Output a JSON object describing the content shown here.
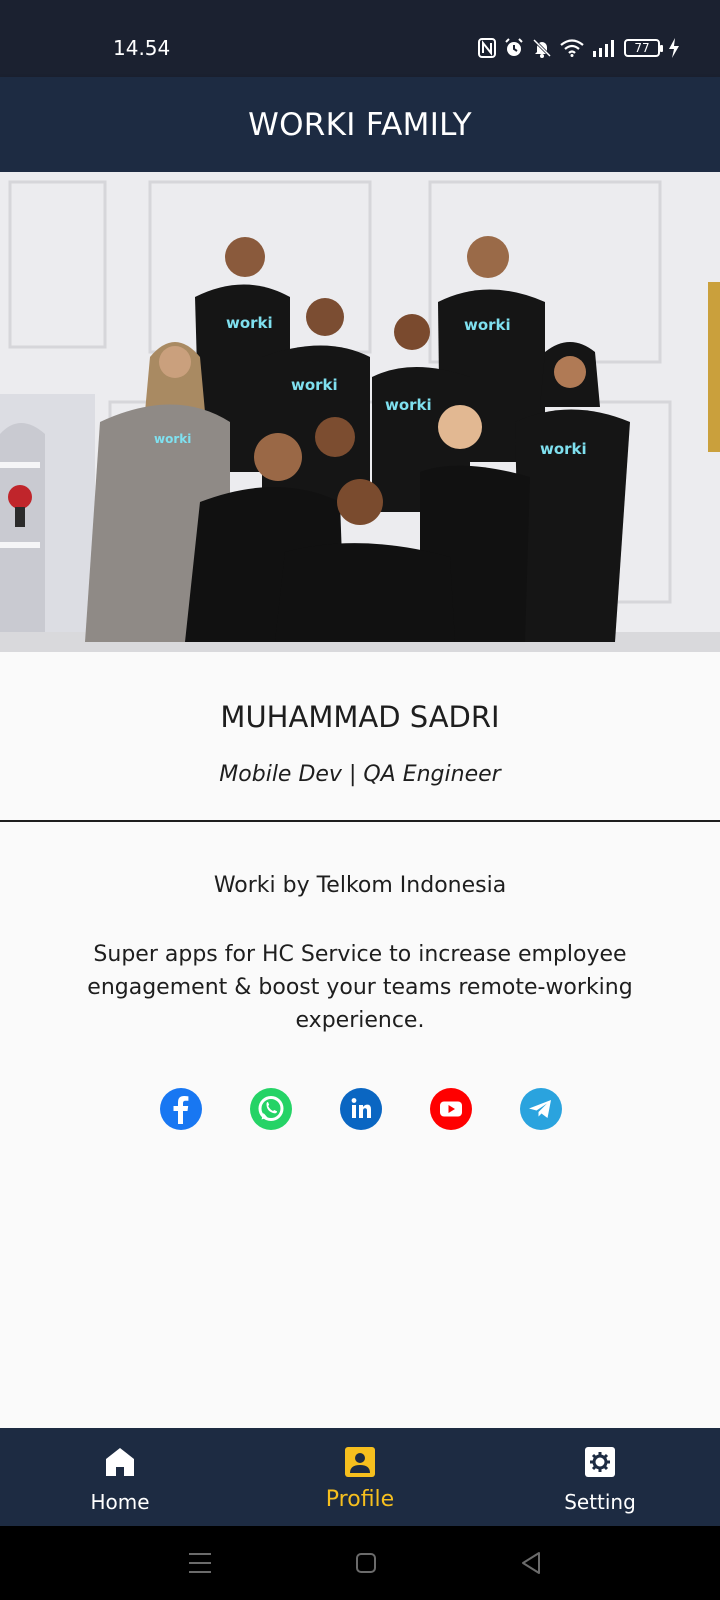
{
  "status_bar": {
    "time": "14.54",
    "battery": "77",
    "icons": [
      "nfc-icon",
      "alarm-icon",
      "mute-icon",
      "wifi-icon",
      "signal-icon",
      "battery-icon",
      "charging-icon"
    ]
  },
  "header": {
    "title": "WORKI FAMILY"
  },
  "photo": {
    "description_icon": "team-photo",
    "shirt_text": "worki"
  },
  "profile": {
    "name": "MUHAMMAD SADRI",
    "role": "Mobile Dev | QA Engineer"
  },
  "about": {
    "company": "Worki by Telkom Indonesia",
    "description": "Super apps for HC Service to increase employee engagement & boost your teams remote-working experience."
  },
  "socials": [
    {
      "icon": "facebook-icon",
      "color": "#1877f2"
    },
    {
      "icon": "whatsapp-icon",
      "color": "#25d366"
    },
    {
      "icon": "linkedin-icon",
      "color": "#0a66c2"
    },
    {
      "icon": "youtube-icon",
      "color": "#ff0000"
    },
    {
      "icon": "telegram-icon",
      "color": "#2aa3de"
    }
  ],
  "bottom_nav": {
    "items": [
      {
        "label": "Home",
        "icon": "home-icon",
        "active": false
      },
      {
        "label": "Profile",
        "icon": "profile-icon",
        "active": true
      },
      {
        "label": "Setting",
        "icon": "gear-icon",
        "active": false
      }
    ]
  },
  "colors": {
    "header_bg": "#1d2b42",
    "active_nav": "#f6bf1e",
    "page_bg": "#fafafa"
  }
}
